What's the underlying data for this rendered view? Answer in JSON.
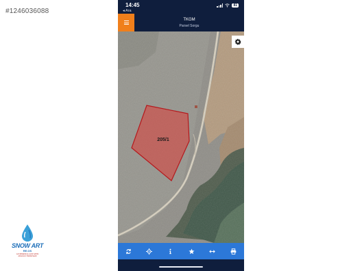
{
  "listing": {
    "id": "#1246036088"
  },
  "status_bar": {
    "time": "14:45",
    "back_label": "◂ Ara",
    "battery": "81"
  },
  "header": {
    "title": "TKGM",
    "subtitle": "Parsel Sorgu"
  },
  "map": {
    "parcel_label": "205/1"
  },
  "toolbar": {
    "items": [
      {
        "name": "refresh",
        "icon": "refresh-icon"
      },
      {
        "name": "locate",
        "icon": "crosshair-icon"
      },
      {
        "name": "info",
        "icon": "info-icon"
      },
      {
        "name": "favorite",
        "icon": "star-icon"
      },
      {
        "name": "measure",
        "icon": "arrows-horizontal-icon"
      },
      {
        "name": "print",
        "icon": "print-icon"
      }
    ]
  },
  "watermark": {
    "brand": "SNOW ART",
    "sub": "RE.OS",
    "tagline_1": "GAYRİMENKUL ALIM SATIM",
    "tagline_2": "ARACILIK HİZMETLERİ"
  },
  "colors": {
    "accent_orange": "#f07f1b",
    "header_navy": "#0f1e3d",
    "toolbar_blue": "#2c78d8",
    "parcel_red": "#d9302c"
  }
}
